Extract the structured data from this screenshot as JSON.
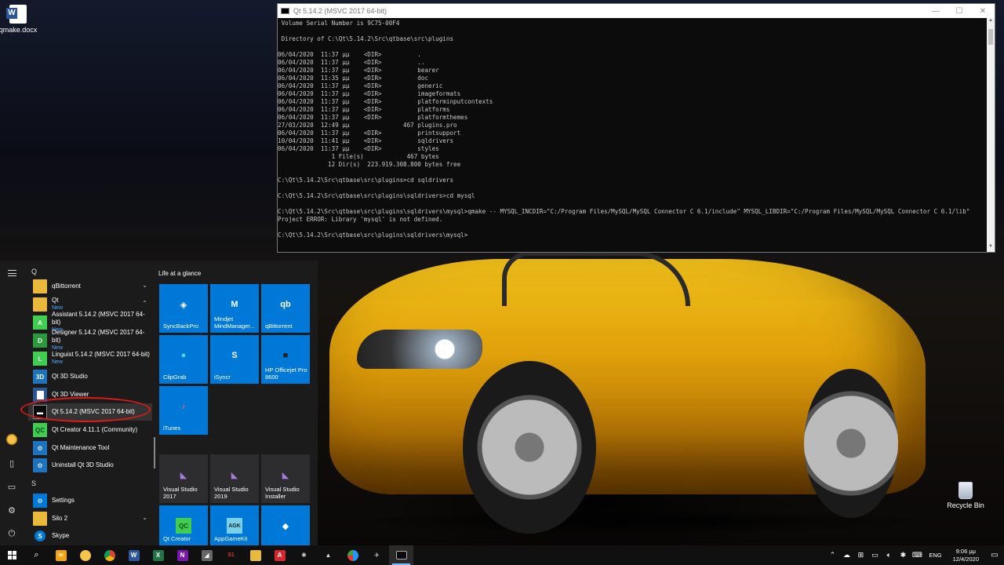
{
  "desktop": {
    "icons": [
      {
        "label": "qmake.docx",
        "icon": "word-doc-icon"
      },
      {
        "label": "Recycle Bin",
        "icon": "recycle-bin-icon"
      }
    ]
  },
  "console": {
    "title": "Qt 5.14.2 (MSVC 2017 64-bit)",
    "controls": {
      "minimize": "—",
      "maximize": "☐",
      "close": "✕"
    },
    "lines": [
      " Volume Serial Number is 9C75-00F4",
      "",
      " Directory of C:\\Qt\\5.14.2\\Src\\qtbase\\src\\plugins",
      "",
      "06/04/2020  11:37 μμ    <DIR>          .",
      "06/04/2020  11:37 μμ    <DIR>          ..",
      "06/04/2020  11:37 μμ    <DIR>          bearer",
      "06/04/2020  11:35 μμ    <DIR>          doc",
      "06/04/2020  11:37 μμ    <DIR>          generic",
      "06/04/2020  11:37 μμ    <DIR>          imageformats",
      "06/04/2020  11:37 μμ    <DIR>          platforminputcontexts",
      "06/04/2020  11:37 μμ    <DIR>          platforms",
      "06/04/2020  11:37 μμ    <DIR>          platformthemes",
      "27/03/2020  12:49 μμ               467 plugins.pro",
      "06/04/2020  11:37 μμ    <DIR>          printsupport",
      "10/04/2020  11:41 μμ    <DIR>          sqldrivers",
      "06/04/2020  11:37 μμ    <DIR>          styles",
      "               1 File(s)            467 bytes",
      "              12 Dir(s)  223.919.308.800 bytes free",
      "",
      "C:\\Qt\\5.14.2\\Src\\qtbase\\src\\plugins>cd sqldrivers",
      "",
      "C:\\Qt\\5.14.2\\Src\\qtbase\\src\\plugins\\sqldrivers>cd mysql",
      "",
      "C:\\Qt\\5.14.2\\Src\\qtbase\\src\\plugins\\sqldrivers\\mysql>qmake -- MYSQL_INCDIR=\"C:/Program Files/MySQL/MySQL Connector C 6.1/include\" MYSQL_LIBDIR=\"C:/Program Files/MySQL/MySQL Connector C 6.1/lib\"",
      "Project ERROR: Library 'mysql' is not defined.",
      "",
      "C:\\Qt\\5.14.2\\Src\\qtbase\\src\\plugins\\sqldrivers\\mysql>"
    ]
  },
  "start_menu": {
    "letters": [
      "Q",
      "S"
    ],
    "apps": [
      {
        "label": "qBittorrent",
        "sub": "",
        "icon": "folder-icon",
        "chevron": "⌄"
      },
      {
        "label": "Qt",
        "sub": "New",
        "icon": "folder-icon",
        "chevron": "⌃"
      },
      {
        "label": "Assistant 5.14.2 (MSVC 2017 64-bit)",
        "sub": "New",
        "icon": "qt-assistant-icon"
      },
      {
        "label": "Designer 5.14.2 (MSVC 2017 64-bit)",
        "sub": "New",
        "icon": "qt-designer-icon"
      },
      {
        "label": "Linguist 5.14.2 (MSVC 2017 64-bit)",
        "sub": "New",
        "icon": "qt-linguist-icon"
      },
      {
        "label": "Qt 3D Studio",
        "sub": "",
        "icon": "qt-3d-studio-icon"
      },
      {
        "label": "Qt 3D Viewer",
        "sub": "",
        "icon": "qt-3d-viewer-icon"
      },
      {
        "label": "Qt 5.14.2 (MSVC 2017 64-bit)",
        "sub": "",
        "icon": "console-icon"
      },
      {
        "label": "Qt Creator 4.11.1 (Community)",
        "sub": "",
        "icon": "qt-creator-icon"
      },
      {
        "label": "Qt Maintenance Tool",
        "sub": "",
        "icon": "qt-maintenance-icon"
      },
      {
        "label": "Uninstall Qt 3D Studio",
        "sub": "",
        "icon": "uninstall-icon"
      },
      {
        "label": "Settings",
        "sub": "",
        "icon": "gear-icon"
      },
      {
        "label": "Silo 2",
        "sub": "",
        "icon": "folder-icon",
        "chevron": "⌄"
      },
      {
        "label": "Skype",
        "sub": "",
        "icon": "skype-icon"
      }
    ],
    "group_title": "Life at a glance",
    "tiles": [
      {
        "label": "SyncBackPro",
        "icon": "syncbackpro-icon",
        "glyph": "◈"
      },
      {
        "label": "Mindjet MindManager...",
        "icon": "mindmanager-icon",
        "glyph": "M"
      },
      {
        "label": "qBittorrent",
        "icon": "qbittorrent-icon",
        "glyph": "qb"
      },
      {
        "label": "ClipGrab",
        "icon": "clipgrab-icon",
        "glyph": "●"
      },
      {
        "label": "iSyncr",
        "icon": "isyncr-icon",
        "glyph": "S"
      },
      {
        "label": "HP Officejet Pro 8600",
        "icon": "printer-icon",
        "glyph": "■"
      },
      {
        "label": "iTunes",
        "icon": "itunes-icon",
        "glyph": "♪"
      },
      {
        "label": "Visual Studio 2017",
        "icon": "visual-studio-icon",
        "glyph": "◣"
      },
      {
        "label": "Visual Studio 2019",
        "icon": "visual-studio-icon",
        "glyph": "◣"
      },
      {
        "label": "Visual Studio Installer",
        "icon": "visual-studio-installer-icon",
        "glyph": "◣"
      },
      {
        "label": "Qt Creator",
        "icon": "qt-creator-icon",
        "glyph": "QC"
      },
      {
        "label": "AppGameKit",
        "icon": "appgamekit-icon",
        "glyph": "AGK"
      },
      {
        "label": "",
        "icon": "unity-icon",
        "glyph": "◆"
      }
    ]
  },
  "taskbar": {
    "language": "ENG",
    "time": "9:06 μμ",
    "date": "12/4/2020",
    "tray_icons": [
      "chevron-up-icon",
      "cloud-icon",
      "network-icon",
      "monitor-icon",
      "volume-icon",
      "bluetooth-icon",
      "keyboard-icon"
    ]
  }
}
